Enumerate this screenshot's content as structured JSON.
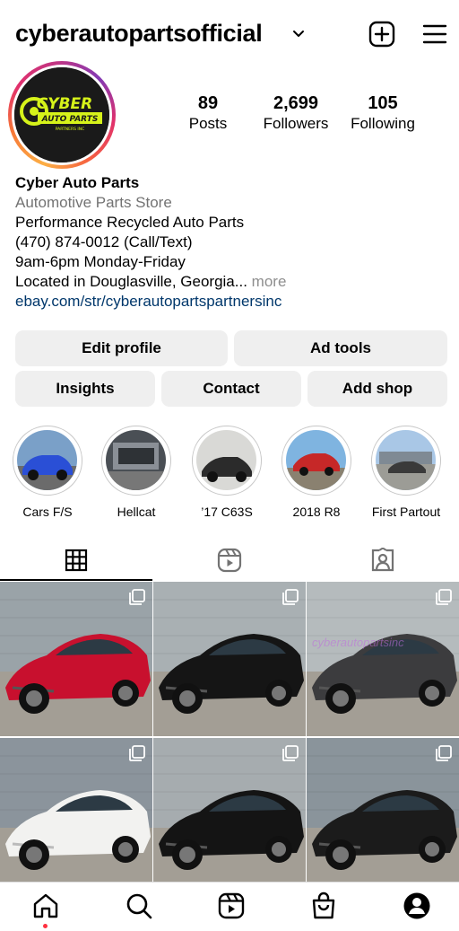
{
  "header": {
    "username": "cyberautopartsofficial"
  },
  "profile": {
    "avatar_text_main": "CYBER",
    "avatar_text_sub": "AUTO PARTS",
    "avatar_text_small": "PARTNERS INC",
    "stats": [
      {
        "value": "89",
        "label": "Posts"
      },
      {
        "value": "2,699",
        "label": "Followers"
      },
      {
        "value": "105",
        "label": "Following"
      }
    ],
    "name": "Cyber Auto Parts",
    "category": "Automotive Parts Store",
    "bio_lines": [
      "Performance Recycled Auto Parts",
      "(470) 874-0012 (Call/Text)",
      "9am-6pm Monday-Friday",
      "Located in Douglasville, Georgia..."
    ],
    "more_label": "more",
    "link": "ebay.com/str/cyberautopartspartnersinc"
  },
  "buttons": {
    "edit_profile": "Edit profile",
    "ad_tools": "Ad tools",
    "insights": "Insights",
    "contact": "Contact",
    "add_shop": "Add shop"
  },
  "highlights": [
    {
      "label": "Cars F/S",
      "color": "#2a4fd6"
    },
    {
      "label": "Hellcat",
      "color": "#8a8f96"
    },
    {
      "label": "’17 C63S",
      "color": "#2b2b2b"
    },
    {
      "label": "2018 R8",
      "color": "#c62828"
    },
    {
      "label": "First Partout",
      "color": "#7f8a94"
    }
  ],
  "tabs": [
    {
      "icon": "grid-icon",
      "active": true
    },
    {
      "icon": "reels-icon",
      "active": false
    },
    {
      "icon": "tagged-icon",
      "active": false
    }
  ],
  "posts": [
    {
      "car": "red-nissan-370z",
      "body": "#c8102e",
      "bg": "#9aa3a8"
    },
    {
      "car": "black-nissan-370z",
      "body": "#151515",
      "bg": "#a9b0b3"
    },
    {
      "car": "gray-dodge-challenger",
      "body": "#3c3c3e",
      "bg": "#b5bbbd"
    },
    {
      "car": "white-nissan-370z-roadster",
      "body": "#f2f2f0",
      "bg": "#8b949c"
    },
    {
      "car": "black-nissan-370z-roadster",
      "body": "#141414",
      "bg": "#a6acaf"
    },
    {
      "car": "black-nissan-370z-damaged",
      "body": "#1b1b1b",
      "bg": "#8a949b"
    }
  ],
  "watermark": "cyberautopartsinc",
  "bottom_nav": [
    "home-icon",
    "search-icon",
    "reels-icon",
    "shop-icon",
    "profile-icon"
  ],
  "colors": {
    "accent_link": "#00376b",
    "button_bg": "#efefef",
    "notification_dot": "#ff3040",
    "logo_yellow": "#d6f21a"
  }
}
